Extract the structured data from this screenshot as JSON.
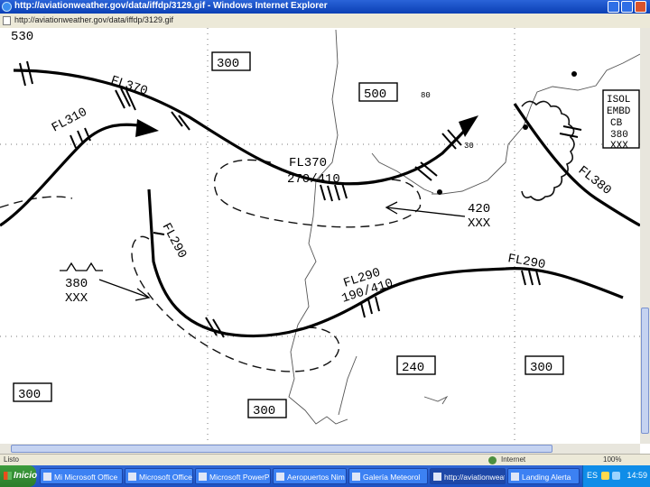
{
  "window": {
    "title": "http://aviationweather.gov/data/iffdp/3129.gif - Windows Internet Explorer",
    "address": "http://aviationweather.gov/data/iffdp/3129.gif"
  },
  "map": {
    "levels": {
      "box_530": "530",
      "box_300_top": "300",
      "box_500": "500",
      "box_240": "240",
      "box_300_right": "300",
      "box_300_left": "300",
      "box_300_bottom": "300"
    },
    "jets": {
      "fl370_upper": "FL370",
      "fl310": "FL310",
      "fl370_mid": "FL370",
      "fl370_mid_layers": "270/410",
      "fl290_left": "FL290",
      "fl290_lower": "FL290",
      "fl290_lower_layers": "190/410",
      "fl290_right": "FL290",
      "fl380": "FL380"
    },
    "turbulence": {
      "top_420": "420",
      "bottom_xxx": "XXX",
      "left_380": "380",
      "left_xxx": "XXX"
    },
    "cb_legend": [
      "ISOL",
      "EMBD",
      "CB",
      "380",
      "XXX"
    ],
    "small_label": "80",
    "small_label2": "30"
  },
  "status": {
    "left": "Listo",
    "zone": "Internet",
    "zoom": "100%"
  },
  "taskbar": {
    "start": "Inicio",
    "tasks": [
      "Mi Microsoft Office",
      "Microsoft Office",
      "Microsoft PowerPoint",
      "Aeropuertos Nim",
      "Galería Meteorol",
      "http://aviationweather",
      "Landing Alerta"
    ],
    "lang": "ES",
    "clock": "14:59"
  },
  "colors": {
    "titlebar": "#0a3fb4",
    "taskbar": "#1d52c3",
    "start": "#2b7d2b"
  }
}
